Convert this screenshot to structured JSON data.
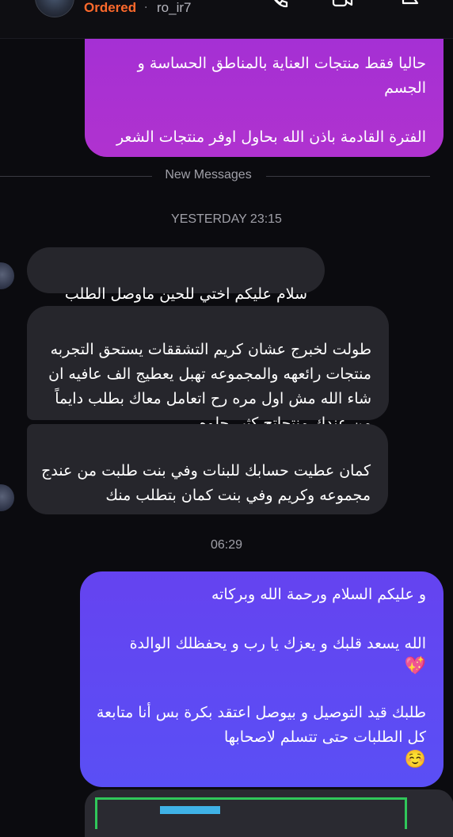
{
  "header": {
    "status": "Ordered",
    "separator": "·",
    "username": "ro_ir7"
  },
  "colors": {
    "status": "#ff6a2c",
    "outgoing_purple": "#a02fd6",
    "outgoing_blue": "#5a4ff5",
    "incoming": "#26262c",
    "background": "#0b0b0f"
  },
  "icons": [
    "avatar",
    "phone-icon",
    "video-call-icon",
    "flag-icon",
    "smiling-face-emoji",
    "sparkling-heart-emoji"
  ],
  "messages": {
    "out1_text": "حاليا فقط منتجات العناية بالمناطق الحساسة و الجسم\n\nالفترة القادمة باذن الله بحاول اوفر منتجات الشعر",
    "new_messages_label": "New Messages",
    "ts1": "YESTERDAY 23:15",
    "in1_text": "سلام عليكم اختي للحين ماوصل الطلب",
    "in2_text": "طولت لخبرج عشان كريم التشققات يستحق التجربه منتجات رائعهه والمجموعه تهبل يعطيج الف عافيه ان شاء الله مش اول مره رح اتعامل معاك بطلب دايماً من عندك منتجاتج كثير حلوه",
    "in3_text": "كمان عطيت حسابك للبنات وفي بنت طلبت من عندج مجموعه وكريم وفي بنت كمان بتطلب منك",
    "ts2": "06:29",
    "out2_p1": "و عليكم السلام ورحمة الله وبركاته",
    "out2_p2": "الله يسعد قلبك و يعزك يا رب و يحفظلك الوالدة",
    "out2_emoji1": "💖",
    "out2_p3": "طلبك قيد التوصيل و بيوصل اعتقد بكرة بس أنا متابعة كل الطلبات حتى تتسلم لاصحابها",
    "out2_emoji2": "☺️"
  }
}
